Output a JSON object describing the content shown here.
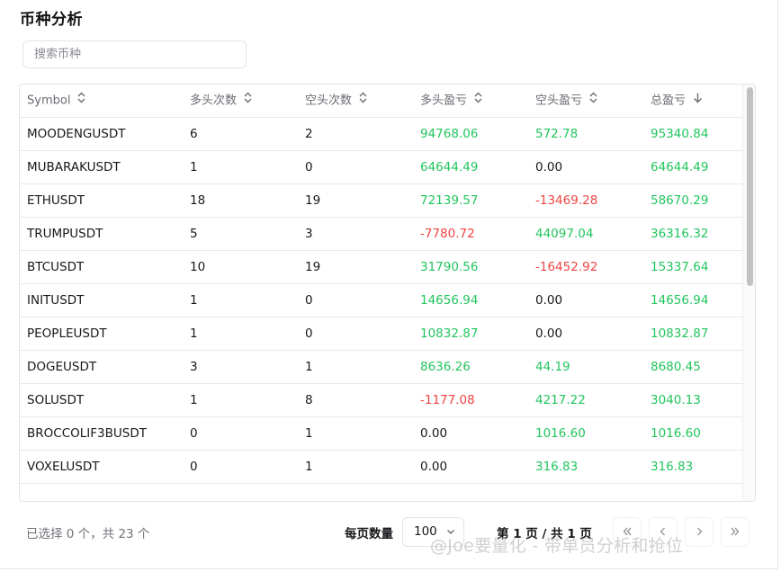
{
  "title": "币种分析",
  "search": {
    "placeholder": "搜索币种",
    "value": ""
  },
  "table": {
    "headers": [
      "Symbol",
      "多头次数",
      "空头次数",
      "多头盈亏",
      "空头盈亏",
      "总盈亏"
    ],
    "sort_icons": [
      "sort-both-icon",
      "sort-both-icon",
      "sort-both-icon",
      "sort-both-icon",
      "sort-both-icon",
      "sort-desc-icon"
    ],
    "rows": [
      [
        "MOODENGUSDT",
        "6",
        "2",
        "94768.06",
        "572.78",
        "95340.84"
      ],
      [
        "MUBARAKUSDT",
        "1",
        "0",
        "64644.49",
        "0.00",
        "64644.49"
      ],
      [
        "ETHUSDT",
        "18",
        "19",
        "72139.57",
        "-13469.28",
        "58670.29"
      ],
      [
        "TRUMPUSDT",
        "5",
        "3",
        "-7780.72",
        "44097.04",
        "36316.32"
      ],
      [
        "BTCUSDT",
        "10",
        "19",
        "31790.56",
        "-16452.92",
        "15337.64"
      ],
      [
        "INITUSDT",
        "1",
        "0",
        "14656.94",
        "0.00",
        "14656.94"
      ],
      [
        "PEOPLEUSDT",
        "1",
        "0",
        "10832.87",
        "0.00",
        "10832.87"
      ],
      [
        "DOGEUSDT",
        "3",
        "1",
        "8636.26",
        "44.19",
        "8680.45"
      ],
      [
        "SOLUSDT",
        "1",
        "8",
        "-1177.08",
        "4217.22",
        "3040.13"
      ],
      [
        "BROCCOLIF3BUSDT",
        "0",
        "1",
        "0.00",
        "1016.60",
        "1016.60"
      ],
      [
        "VOXELUSDT",
        "0",
        "1",
        "0.00",
        "316.83",
        "316.83"
      ]
    ]
  },
  "footer": {
    "selected_info": "已选择 0 个，共 23 个",
    "rows_per_page_label": "每页数量",
    "rows_per_page_value": "100",
    "page_info": "第 1 页 / 共 1 页",
    "buttons": [
      "first-page-icon",
      "prev-page-icon",
      "next-page-icon",
      "last-page-icon"
    ]
  },
  "watermark": "@Joe要量化 - 带单员分析和抢位",
  "colors": {
    "positive": "#22c55e",
    "negative": "#ef4444",
    "text": "#18181b",
    "muted": "#6b6b73"
  }
}
